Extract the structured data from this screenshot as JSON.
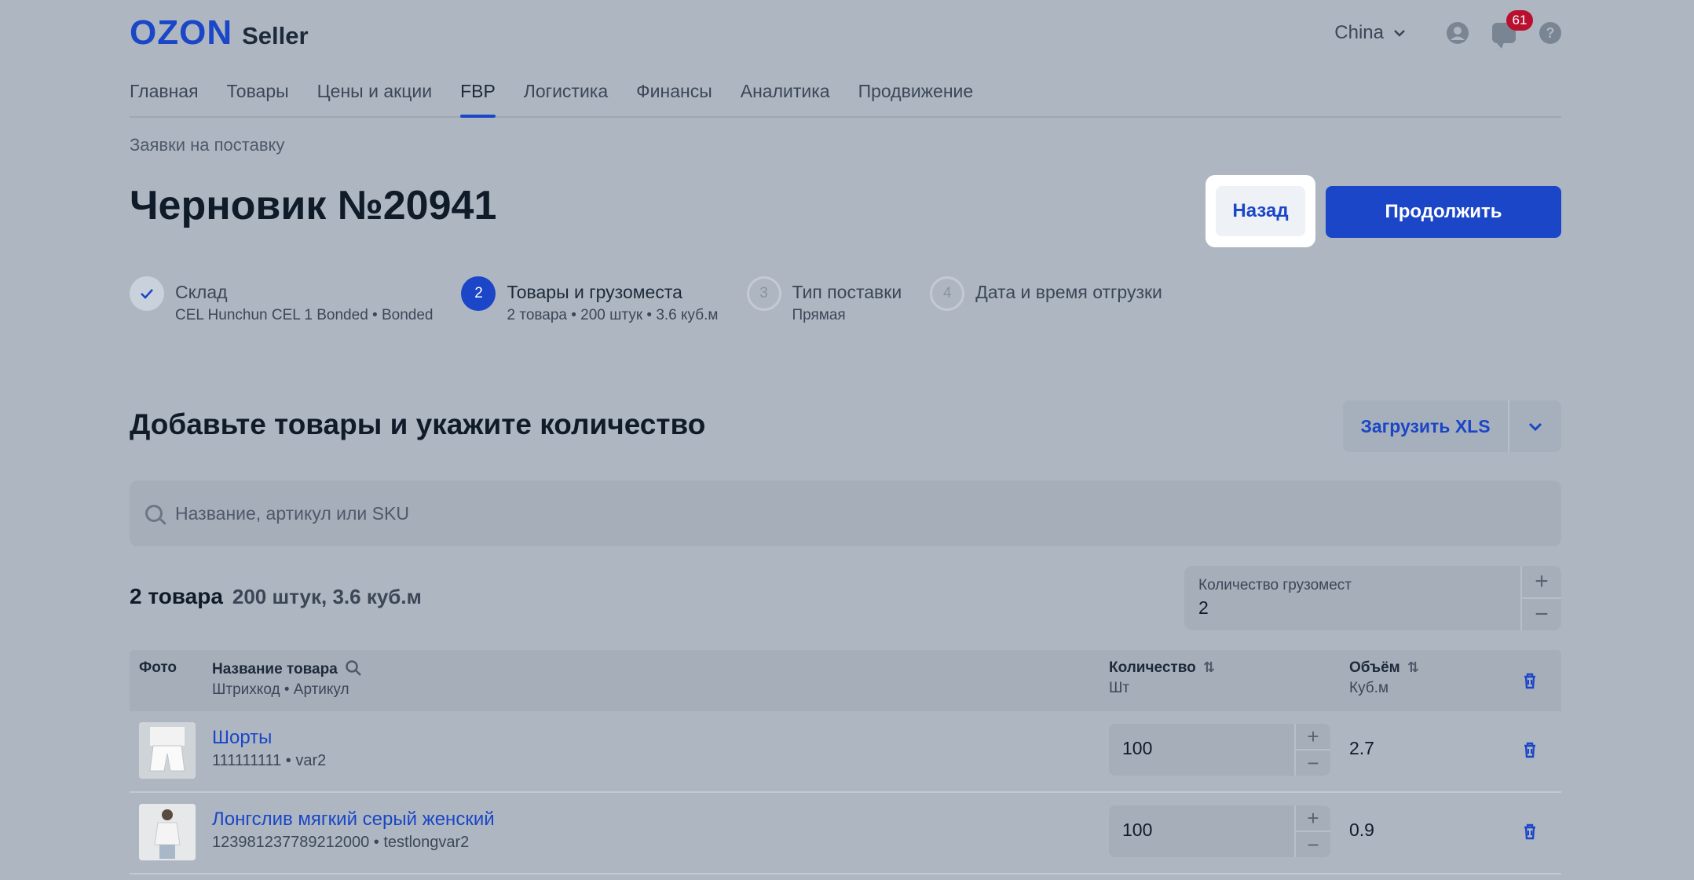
{
  "header": {
    "logo_ozon": "OZON",
    "logo_seller": "Seller",
    "region": "China",
    "notifications_count": "61"
  },
  "nav": {
    "items": [
      "Главная",
      "Товары",
      "Цены и акции",
      "FBP",
      "Логистика",
      "Финансы",
      "Аналитика",
      "Продвижение"
    ],
    "active": "FBP"
  },
  "breadcrumb": "Заявки на поставку",
  "page_title": "Черновик №20941",
  "actions": {
    "back": "Назад",
    "continue": "Продолжить"
  },
  "steps": [
    {
      "number": "",
      "title": "Склад",
      "subtitle": "CEL Hunchun CEL 1 Bonded • Bonded",
      "state": "done"
    },
    {
      "number": "2",
      "title": "Товары и грузоместа",
      "subtitle": "2 товара • 200 штук • 3.6 куб.м",
      "state": "current"
    },
    {
      "number": "3",
      "title": "Тип поставки",
      "subtitle": "Прямая",
      "state": "todo"
    },
    {
      "number": "4",
      "title": "Дата и время отгрузки",
      "subtitle": "",
      "state": "todo"
    }
  ],
  "section": {
    "title": "Добавьте товары и укажите количество",
    "upload_label": "Загрузить XLS"
  },
  "search": {
    "placeholder": "Название, артикул или SKU",
    "value": ""
  },
  "summary": {
    "count": "2 товара",
    "meta": "200 штук, 3.6 куб.м"
  },
  "cargo": {
    "label": "Количество грузомест",
    "value": "2"
  },
  "table": {
    "columns": {
      "photo": "Фото",
      "name": "Название товара",
      "name_sub": "Штрихкод • Артикул",
      "quantity": "Количество",
      "quantity_sub": "Шт",
      "volume": "Объём",
      "volume_sub": "Куб.м"
    },
    "rows": [
      {
        "name": "Шорты",
        "meta": "111111111 • var2",
        "quantity": "100",
        "volume": "2.7"
      },
      {
        "name": "Лонгслив мягкий серый женский",
        "meta": "123981237789212000 • testlongvar2",
        "quantity": "100",
        "volume": "0.9"
      }
    ]
  },
  "colors": {
    "accent": "#1a46c7",
    "badge": "#b8102e",
    "overlay_bg": "#aeb7c1"
  },
  "icons": [
    "chevron-down-icon",
    "user-icon",
    "chat-icon",
    "help-icon",
    "check-icon",
    "search-icon",
    "sort-icon",
    "trash-icon",
    "plus-icon",
    "minus-icon"
  ]
}
